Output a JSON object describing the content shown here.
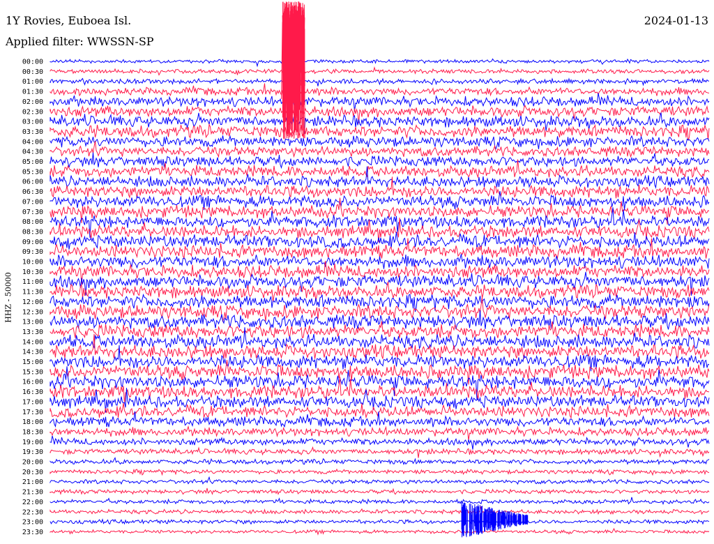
{
  "header": {
    "station": "1Y Rovies, Euboea Isl.",
    "filter": "Applied filter: WWSSN-SP",
    "date": "2024-01-13"
  },
  "axis": {
    "ylabel": "HHZ - 50000"
  },
  "colors": {
    "trace_a": "#0000ff",
    "trace_b": "#ff1a4a",
    "background": "#ffffff"
  },
  "chart_data": {
    "type": "helicorder",
    "rows": [
      "00:00",
      "00:30",
      "01:00",
      "01:30",
      "02:00",
      "02:30",
      "03:00",
      "03:30",
      "04:00",
      "04:30",
      "05:00",
      "05:30",
      "06:00",
      "06:30",
      "07:00",
      "07:30",
      "08:00",
      "08:30",
      "09:00",
      "09:30",
      "10:00",
      "10:30",
      "11:00",
      "11:30",
      "12:00",
      "12:30",
      "13:00",
      "13:30",
      "14:00",
      "14:30",
      "15:00",
      "15:30",
      "16:00",
      "16:30",
      "17:00",
      "17:30",
      "18:00",
      "18:30",
      "19:00",
      "19:30",
      "20:00",
      "20:30",
      "21:00",
      "21:30",
      "22:00",
      "22:30",
      "23:00",
      "23:30"
    ],
    "amplitude_level": [
      0.25,
      0.3,
      0.35,
      0.55,
      0.7,
      0.75,
      0.8,
      0.85,
      0.75,
      0.7,
      0.75,
      0.8,
      0.8,
      0.85,
      0.85,
      0.85,
      0.85,
      0.85,
      0.9,
      0.9,
      0.9,
      0.9,
      0.9,
      0.9,
      0.95,
      0.95,
      0.95,
      0.95,
      0.95,
      0.95,
      0.95,
      0.95,
      0.95,
      0.9,
      0.85,
      0.8,
      0.7,
      0.6,
      0.5,
      0.4,
      0.35,
      0.3,
      0.3,
      0.3,
      0.3,
      0.3,
      0.3,
      0.25
    ]
  }
}
